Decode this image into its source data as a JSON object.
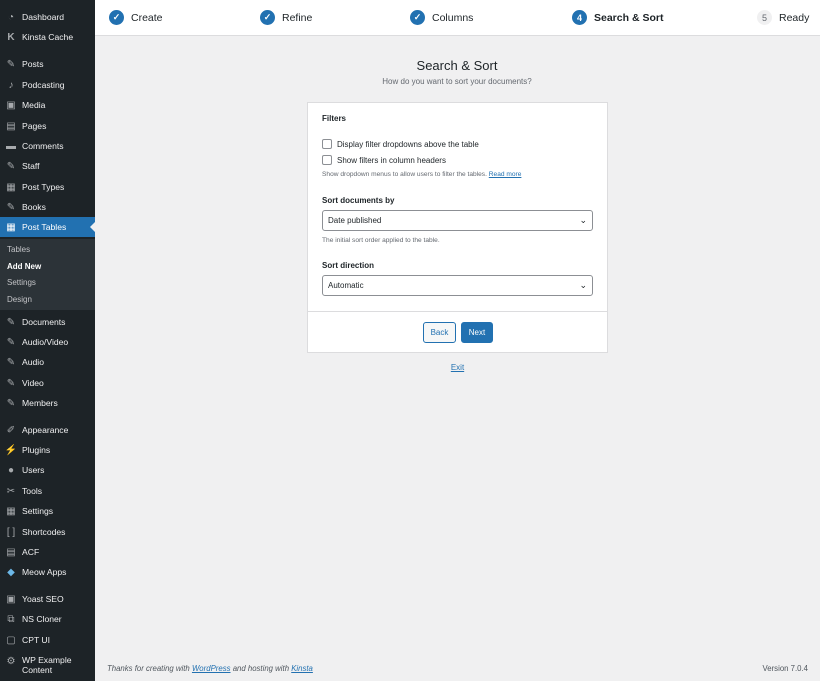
{
  "sidebar": {
    "items": [
      {
        "label": "Dashboard",
        "icon": "dashboard-icon"
      },
      {
        "label": "Kinsta Cache",
        "icon": "kinsta-icon"
      },
      {
        "label": "Posts",
        "icon": "pin-icon"
      },
      {
        "label": "Podcasting",
        "icon": "microphone-icon"
      },
      {
        "label": "Media",
        "icon": "media-icon"
      },
      {
        "label": "Pages",
        "icon": "pages-icon"
      },
      {
        "label": "Comments",
        "icon": "comments-icon"
      },
      {
        "label": "Staff",
        "icon": "pin-icon"
      },
      {
        "label": "Post Types",
        "icon": "post-types-icon"
      },
      {
        "label": "Books",
        "icon": "pin-icon"
      },
      {
        "label": "Post Tables",
        "icon": "table-icon"
      },
      {
        "label": "Documents",
        "icon": "pin-icon"
      },
      {
        "label": "Audio/Video",
        "icon": "pin-icon"
      },
      {
        "label": "Audio",
        "icon": "pin-icon"
      },
      {
        "label": "Video",
        "icon": "pin-icon"
      },
      {
        "label": "Members",
        "icon": "pin-icon"
      },
      {
        "label": "Appearance",
        "icon": "appearance-icon"
      },
      {
        "label": "Plugins",
        "icon": "plugins-icon"
      },
      {
        "label": "Users",
        "icon": "users-icon"
      },
      {
        "label": "Tools",
        "icon": "tools-icon"
      },
      {
        "label": "Settings",
        "icon": "settings-icon"
      },
      {
        "label": "Shortcodes",
        "icon": "shortcodes-icon"
      },
      {
        "label": "ACF",
        "icon": "acf-icon"
      },
      {
        "label": "Meow Apps",
        "icon": "meow-icon"
      },
      {
        "label": "Yoast SEO",
        "icon": "yoast-icon"
      },
      {
        "label": "NS Cloner",
        "icon": "cloner-icon"
      },
      {
        "label": "CPT UI",
        "icon": "cptui-icon"
      },
      {
        "label": "WP Example",
        "label2": "Content",
        "icon": "gear-icon"
      }
    ],
    "submenu": [
      "Tables",
      "Add New",
      "Settings",
      "Design"
    ]
  },
  "steps": [
    {
      "label": "Create",
      "state": "done"
    },
    {
      "label": "Refine",
      "state": "done"
    },
    {
      "label": "Columns",
      "state": "done"
    },
    {
      "label": "Search & Sort",
      "num": "4",
      "state": "current"
    },
    {
      "label": "Ready",
      "num": "5",
      "state": "todo"
    }
  ],
  "main": {
    "title": "Search & Sort",
    "subtitle": "How do you want to sort your documents?",
    "filters": {
      "title": "Filters",
      "option1": "Display filter dropdowns above the table",
      "option2": "Show filters in column headers",
      "help": "Show dropdown menus to allow users to filter the tables.",
      "help_link": "Read more"
    },
    "sort_by": {
      "label": "Sort documents by",
      "value": "Date published",
      "help": "The initial sort order applied to the table."
    },
    "sort_direction": {
      "label": "Sort direction",
      "value": "Automatic"
    },
    "back_label": "Back",
    "next_label": "Next",
    "exit_label": "Exit"
  },
  "footer": {
    "left_prefix": "Thanks for creating with",
    "wordpress": "WordPress",
    "left_middle": "and hosting with",
    "kinsta": "Kinsta",
    "version": "Version 7.0.4"
  },
  "colors": {
    "accent": "#2271b1",
    "sidebar": "#1d2327",
    "background": "#f0f0f1"
  }
}
